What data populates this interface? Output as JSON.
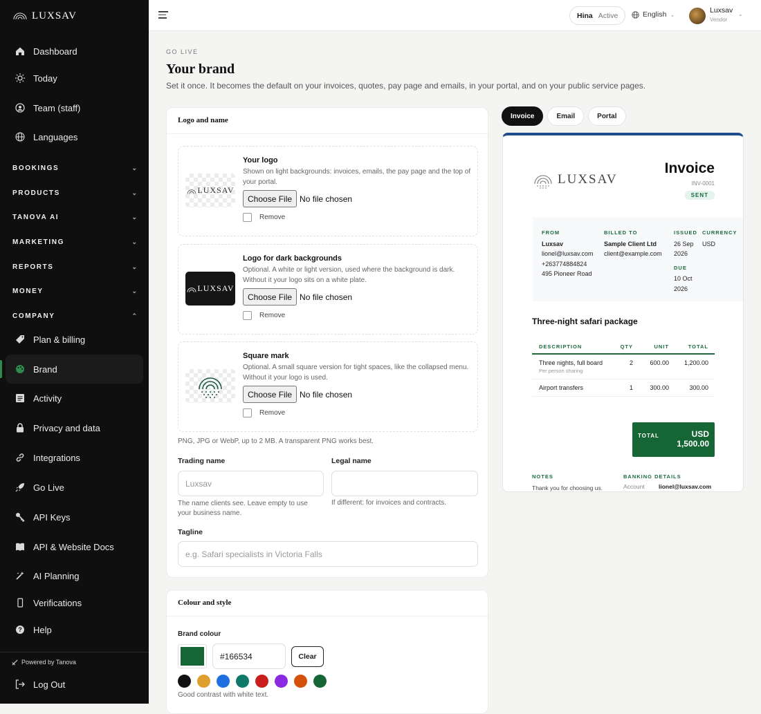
{
  "app": {
    "brand": "LUXSAV",
    "powered_by": "Powered by Tanova",
    "logout": "Log Out"
  },
  "nav_top": [
    {
      "label": "Dashboard",
      "icon": "home-icon"
    },
    {
      "label": "Today",
      "icon": "sun-icon"
    },
    {
      "label": "Team (staff)",
      "icon": "team-icon"
    },
    {
      "label": "Languages",
      "icon": "globe-icon"
    }
  ],
  "sections": [
    "BOOKINGS",
    "PRODUCTS",
    "TANOVA AI",
    "MARKETING",
    "REPORTS",
    "MONEY",
    "COMPANY"
  ],
  "nav_company": [
    {
      "label": "Plan & billing",
      "icon": "tag-icon"
    },
    {
      "label": "Brand",
      "icon": "palette-icon",
      "active": true
    },
    {
      "label": "Activity",
      "icon": "list-icon"
    },
    {
      "label": "Privacy and data",
      "icon": "lock-icon"
    },
    {
      "label": "Integrations",
      "icon": "link-icon"
    },
    {
      "label": "Go Live",
      "icon": "rocket-icon"
    },
    {
      "label": "API Keys",
      "icon": "key-icon"
    },
    {
      "label": "API & Website Docs",
      "icon": "book-icon"
    },
    {
      "label": "AI Planning",
      "icon": "sparkle-icon"
    },
    {
      "label": "Verifications",
      "icon": "phone-icon"
    },
    {
      "label": "Help",
      "icon": "help-icon"
    }
  ],
  "topbar": {
    "user": "Hina",
    "status": "Active",
    "language": "English",
    "account": "Luxsav",
    "role": "Vendor"
  },
  "page": {
    "eyebrow": "GO LIVE",
    "title": "Your brand",
    "subtitle": "Set it once. It becomes the default on your invoices, quotes, pay page and emails, in your portal, and on your public service pages."
  },
  "logo_card": {
    "title": "Logo and name",
    "boxes": [
      {
        "title": "Your logo",
        "desc": "Shown on light backgrounds: invoices, emails, the pay page and the top of your portal.",
        "thumb": "LUXSAV"
      },
      {
        "title": "Logo for dark backgrounds",
        "desc": "Optional. A white or light version, used where the background is dark. Without it your logo sits on a white plate.",
        "thumb": "LUXSAV"
      },
      {
        "title": "Square mark",
        "desc": "Optional. A small square version for tight spaces, like the collapsed menu. Without it your logo is used.",
        "thumb": ""
      }
    ],
    "choose_file": "Choose File",
    "no_file": "No file chosen",
    "remove": "Remove",
    "formats_hint": "PNG, JPG or WebP, up to 2 MB. A transparent PNG works best.",
    "trading_label": "Trading name",
    "trading_placeholder": "Luxsav",
    "trading_hint": "The name clients see. Leave empty to use your business name.",
    "legal_label": "Legal name",
    "legal_placeholder": "",
    "legal_hint": "If different: for invoices and contracts.",
    "tagline_label": "Tagline",
    "tagline_placeholder": "e.g. Safari specialists in Victoria Falls"
  },
  "style_card": {
    "title": "Colour and style",
    "brand_colour_label": "Brand colour",
    "hex": "#166534",
    "clear": "Clear",
    "presets": [
      "#111111",
      "#e0a030",
      "#1e6fe0",
      "#0f7a6a",
      "#c81e1e",
      "#8a2be2",
      "#d4510b",
      "#166534"
    ],
    "contrast_hint": "Good contrast with white text."
  },
  "preview": {
    "tabs": [
      "Invoice",
      "Email",
      "Portal"
    ],
    "active_tab": "Invoice",
    "invoice": {
      "logo": "LUXSAV",
      "title": "Invoice",
      "number": "INV-0001",
      "status": "SENT",
      "from_h": "FROM",
      "from": [
        "Luxsav",
        "lionel@luxsav.com",
        "+263774884824",
        "495 Pioneer Road"
      ],
      "billed_h": "BILLED TO",
      "billed": [
        "Sample Client Ltd",
        "client@example.com"
      ],
      "issued_h": "ISSUED",
      "issued": "26 Sep 2026",
      "due_h": "DUE",
      "due": "10 Oct 2026",
      "currency_h": "CURRENCY",
      "currency": "USD",
      "package": "Three-night safari package",
      "columns": [
        "DESCRIPTION",
        "QTY",
        "UNIT",
        "TOTAL"
      ],
      "rows": [
        {
          "desc": "Three nights, full board",
          "sub": "Per person sharing",
          "qty": "2",
          "unit": "600.00",
          "total": "1,200.00"
        },
        {
          "desc": "Airport transfers",
          "sub": "",
          "qty": "1",
          "unit": "300.00",
          "total": "300.00"
        }
      ],
      "total_label": "TOTAL",
      "total_currency": "USD",
      "total_value": "1,500.00",
      "notes_h": "NOTES",
      "notes": "Thank you for choosing us.",
      "bank_h": "BANKING DETAILS",
      "bank_key": "Account Name",
      "bank_val": "lionel@luxsav.com"
    }
  },
  "colors": {
    "accent": "#166534",
    "sidebar": "#0f0f0f",
    "preview_top": "#1d4d8c"
  }
}
